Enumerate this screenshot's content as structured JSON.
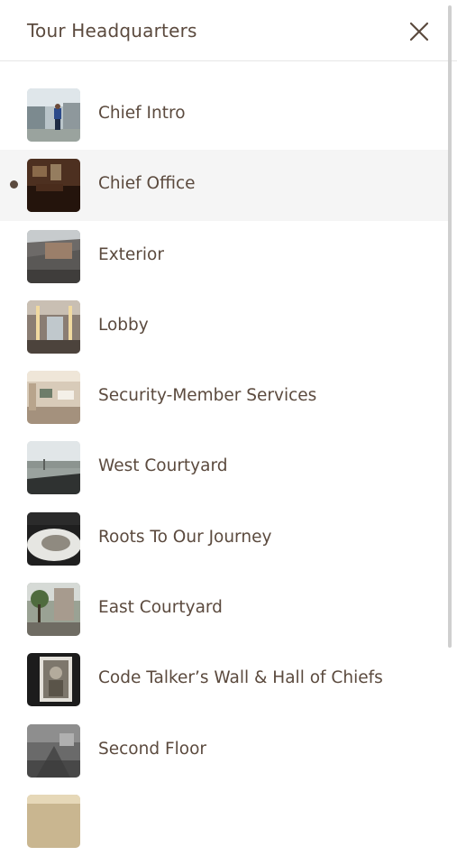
{
  "header": {
    "title": "Tour Headquarters",
    "close_icon": "close-icon"
  },
  "colors": {
    "text": "#5b4a3e",
    "active_background": "#f5f5f5",
    "divider": "#e6e6e6"
  },
  "tour": {
    "active_index": 1,
    "items": [
      {
        "label": "Chief Intro"
      },
      {
        "label": "Chief Office"
      },
      {
        "label": "Exterior"
      },
      {
        "label": "Lobby"
      },
      {
        "label": "Security-Member Services"
      },
      {
        "label": "West Courtyard"
      },
      {
        "label": "Roots To Our Journey"
      },
      {
        "label": "East Courtyard"
      },
      {
        "label": "Code Talker’s Wall & Hall of Chiefs"
      },
      {
        "label": "Second Floor"
      }
    ]
  }
}
